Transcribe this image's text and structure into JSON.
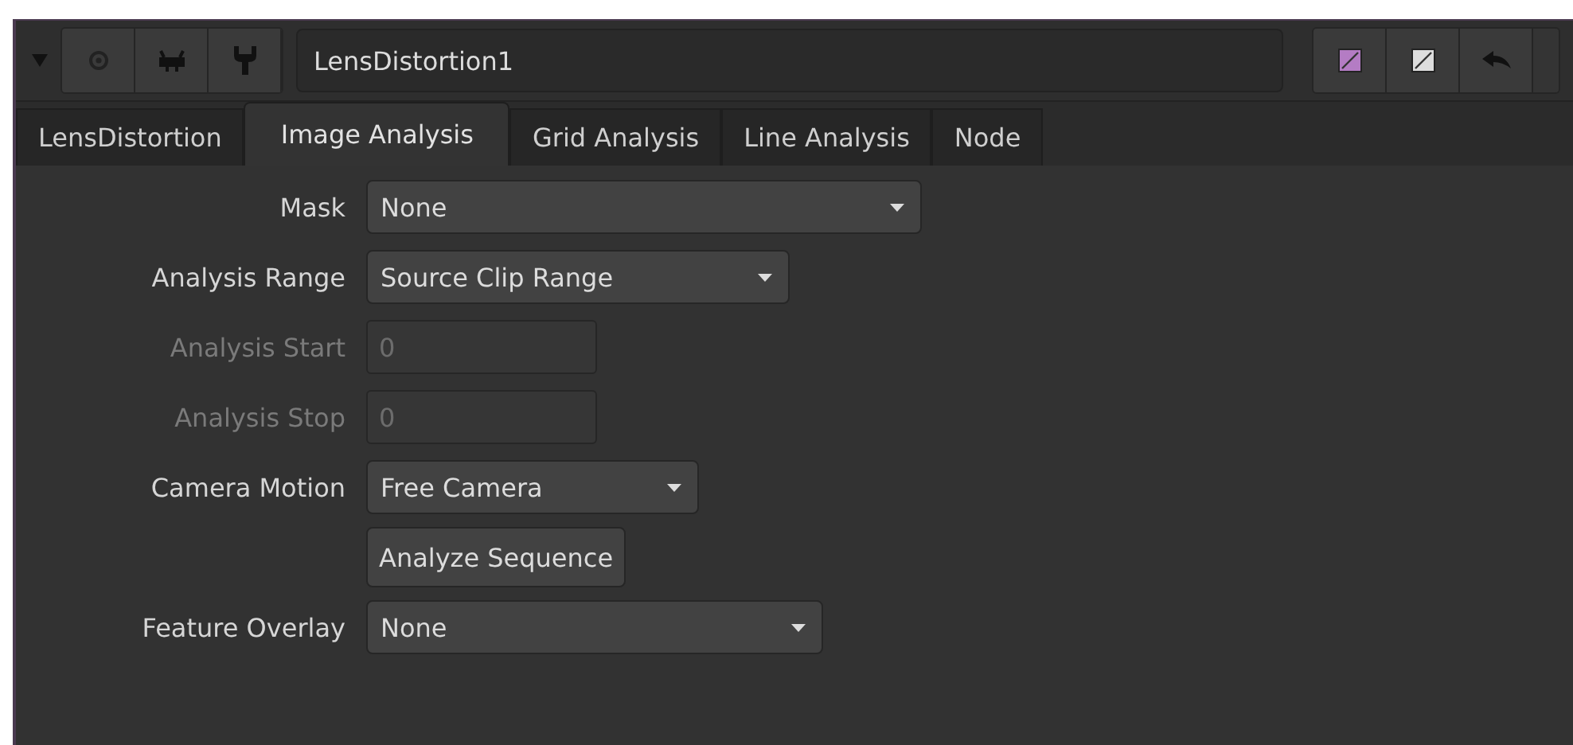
{
  "header": {
    "node_name": "LensDistortion1"
  },
  "tabs": [
    {
      "label": "LensDistortion",
      "selected": false
    },
    {
      "label": "Image Analysis",
      "selected": true
    },
    {
      "label": "Grid Analysis",
      "selected": false
    },
    {
      "label": "Line Analysis",
      "selected": false
    },
    {
      "label": "Node",
      "selected": false
    }
  ],
  "rows": [
    {
      "kind": "dropdown",
      "label": "Mask",
      "value": "None"
    },
    {
      "kind": "dropdown",
      "label": "Analysis Range",
      "value": "Source Clip Range"
    },
    {
      "kind": "field",
      "label": "Analysis Start",
      "value": "0",
      "disabled": true
    },
    {
      "kind": "field",
      "label": "Analysis Stop",
      "value": "0",
      "disabled": true
    },
    {
      "kind": "dropdown",
      "label": "Camera Motion",
      "value": "Free Camera"
    },
    {
      "kind": "button",
      "label": "Analyze Sequence"
    },
    {
      "kind": "dropdown",
      "label": "Feature Overlay",
      "value": "None"
    }
  ]
}
